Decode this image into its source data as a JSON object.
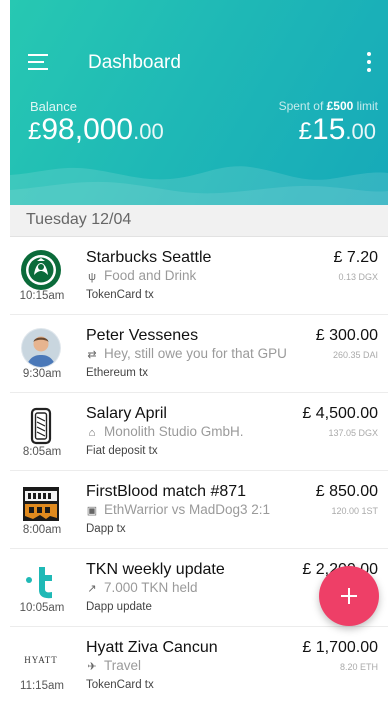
{
  "header": {
    "title": "Dashboard",
    "balance_label": "Balance",
    "balance_currency": "£",
    "balance_whole": "98,000",
    "balance_decimal": ".00",
    "spent_label_prefix": "Spent of ",
    "spent_limit": "£500",
    "spent_label_suffix": " limit",
    "spent_currency": "£",
    "spent_whole": "15",
    "spent_decimal": ".00",
    "accent_color": "#1fb9b6"
  },
  "day_header": "Tuesday 12/04",
  "transactions": [
    {
      "name": "Starbucks Seattle",
      "icon": "fork-knife-icon",
      "subtitle": "Food and Drink",
      "type": "TokenCard tx",
      "time": "10:15am",
      "amount": "£ 7.20",
      "crypto": "0.13 DGX",
      "avatar": "starbucks-logo"
    },
    {
      "name": "Peter Vessenes",
      "icon": "arrows-icon",
      "subtitle": "Hey, still owe you for that GPU",
      "type": "Ethereum tx",
      "time": "9:30am",
      "amount": "£ 300.00",
      "crypto": "260.35 DAI",
      "avatar": "person-photo"
    },
    {
      "name": "Salary April",
      "icon": "bank-icon",
      "subtitle": "Monolith Studio GmbH.",
      "type": "Fiat deposit tx",
      "time": "8:05am",
      "amount": "£ 4,500.00",
      "crypto": "137.05 DGX",
      "avatar": "ingot-icon"
    },
    {
      "name": "FirstBlood match #871",
      "icon": "gamepad-icon",
      "subtitle": "EthWarrior vs MadDog3 2:1",
      "type": "Dapp tx",
      "time": "8:00am",
      "amount": "£ 850.00",
      "crypto": "120.00 1ST",
      "avatar": "firstblood-logo"
    },
    {
      "name": "TKN weekly update",
      "icon": "trend-icon",
      "subtitle": "7.000 TKN held",
      "type": "Dapp update",
      "time": "10:05am",
      "amount": "£ 2,200.00",
      "crypto": "",
      "avatar": "tkn-logo"
    },
    {
      "name": "Hyatt Ziva Cancun",
      "icon": "plane-icon",
      "subtitle": "Travel",
      "type": "TokenCard tx",
      "time": "11:15am",
      "amount": "£ 1,700.00",
      "crypto": "8.20 ETH",
      "avatar": "hyatt-logo"
    }
  ],
  "hyatt_logo_text": "HYATT",
  "fab_color": "#ee3f67"
}
